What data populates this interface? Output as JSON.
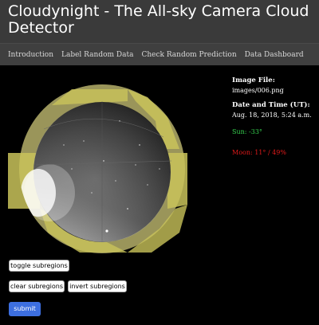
{
  "header": {
    "title": "Cloudynight - The All-sky Camera Cloud Detector"
  },
  "nav": {
    "items": [
      "Introduction",
      "Label Random Data",
      "Check Random Prediction",
      "Data Dashboard"
    ]
  },
  "info": {
    "image_file_label": "Image File:",
    "image_file_value": "images/006.png",
    "datetime_label": "Date and Time (UT):",
    "datetime_value": "Aug. 18, 2018, 5:24 a.m.",
    "sun": "Sun: -33°",
    "moon": "Moon: 11° / 49%"
  },
  "buttons": {
    "toggle": "toggle subregions",
    "clear": "clear subregions",
    "invert": "invert subregions",
    "submit": "submit"
  },
  "colors": {
    "header_bg": "#3a3a3a",
    "overlay": "#c9c35a",
    "sun": "#36d04f",
    "moon": "#e11a1a",
    "submit_bg": "#3d6fe0"
  }
}
